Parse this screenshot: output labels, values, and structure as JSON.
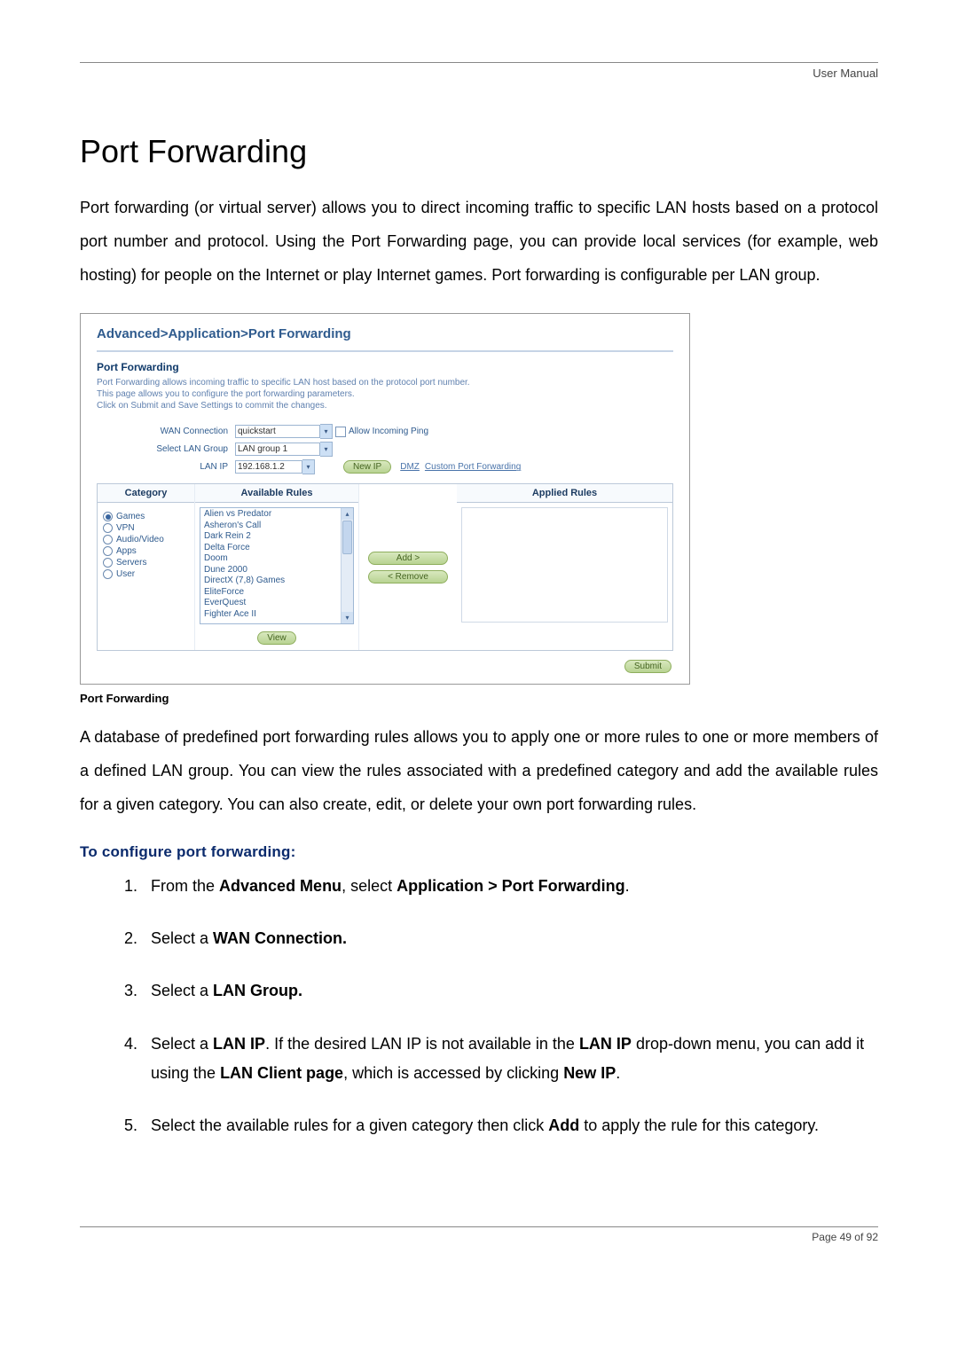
{
  "header": {
    "right": "User Manual"
  },
  "title": "Port Forwarding",
  "intro": "Port forwarding (or virtual server) allows you to direct incoming traffic to specific LAN hosts based on a protocol port number and protocol. Using the Port Forwarding page, you can provide local services (for example, web hosting) for people on the Internet or play Internet games. Port forwarding is configurable per LAN group.",
  "screenshot": {
    "breadcrumb": "Advanced>Application>Port Forwarding",
    "section_title": "Port Forwarding",
    "desc_line1": "Port Forwarding allows incoming traffic to specific LAN host based on the protocol port number.",
    "desc_line2": "This page allows you to configure the port forwarding parameters.",
    "desc_line3": "Click on Submit and Save Settings to commit the changes.",
    "fields": {
      "wan_label": "WAN Connection",
      "wan_value": "quickstart",
      "allow_ping": "Allow Incoming Ping",
      "lan_group_label": "Select LAN Group",
      "lan_group_value": "LAN group 1",
      "lan_ip_label": "LAN IP",
      "lan_ip_value": "192.168.1.2",
      "new_ip_btn": "New IP",
      "dmz": "DMZ",
      "custom_pf": "Custom Port Forwarding"
    },
    "table": {
      "hdr_category": "Category",
      "hdr_available": "Available Rules",
      "hdr_applied": "Applied Rules",
      "categories": [
        {
          "label": "Games",
          "selected": true
        },
        {
          "label": "VPN",
          "selected": false
        },
        {
          "label": "Audio/Video",
          "selected": false
        },
        {
          "label": "Apps",
          "selected": false
        },
        {
          "label": "Servers",
          "selected": false
        },
        {
          "label": "User",
          "selected": false
        }
      ],
      "available": [
        "Alien vs Predator",
        "Asheron's Call",
        "Dark Rein 2",
        "Delta Force",
        "Doom",
        "Dune 2000",
        "DirectX (7,8) Games",
        "EliteForce",
        "EverQuest",
        "Fighter Ace II"
      ],
      "add_btn": "Add >",
      "remove_btn": "< Remove",
      "view_btn": "View"
    },
    "submit_btn": "Submit"
  },
  "caption": "Port Forwarding",
  "para2": "A database of predefined port forwarding rules allows you to apply one or more rules to one or more members of a defined LAN group. You can view the rules associated with a predefined category and add the available rules for a given category. You can also create, edit, or delete your own port forwarding rules.",
  "subhead": "To configure port forwarding:",
  "steps": {
    "s1a": "From the ",
    "s1b": "Advanced Menu",
    "s1c": ", select ",
    "s1d": "Application > Port Forwarding",
    "s1e": ".",
    "s2a": "Select a ",
    "s2b": "WAN Connection.",
    "s3a": "Select a ",
    "s3b": "LAN Group.",
    "s4a": "Select a ",
    "s4b": "LAN IP",
    "s4c": ". If the desired LAN IP is not available in the ",
    "s4d": "LAN IP",
    "s4e": " drop-down menu, you can add it using the ",
    "s4f": "LAN Client page",
    "s4g": ", which is accessed by clicking ",
    "s4h": "New IP",
    "s4i": ".",
    "s5a": "Select the available rules for a given category then click ",
    "s5b": "Add",
    "s5c": " to apply the rule for this category."
  },
  "footer": {
    "text": "Page 49 of 92"
  }
}
